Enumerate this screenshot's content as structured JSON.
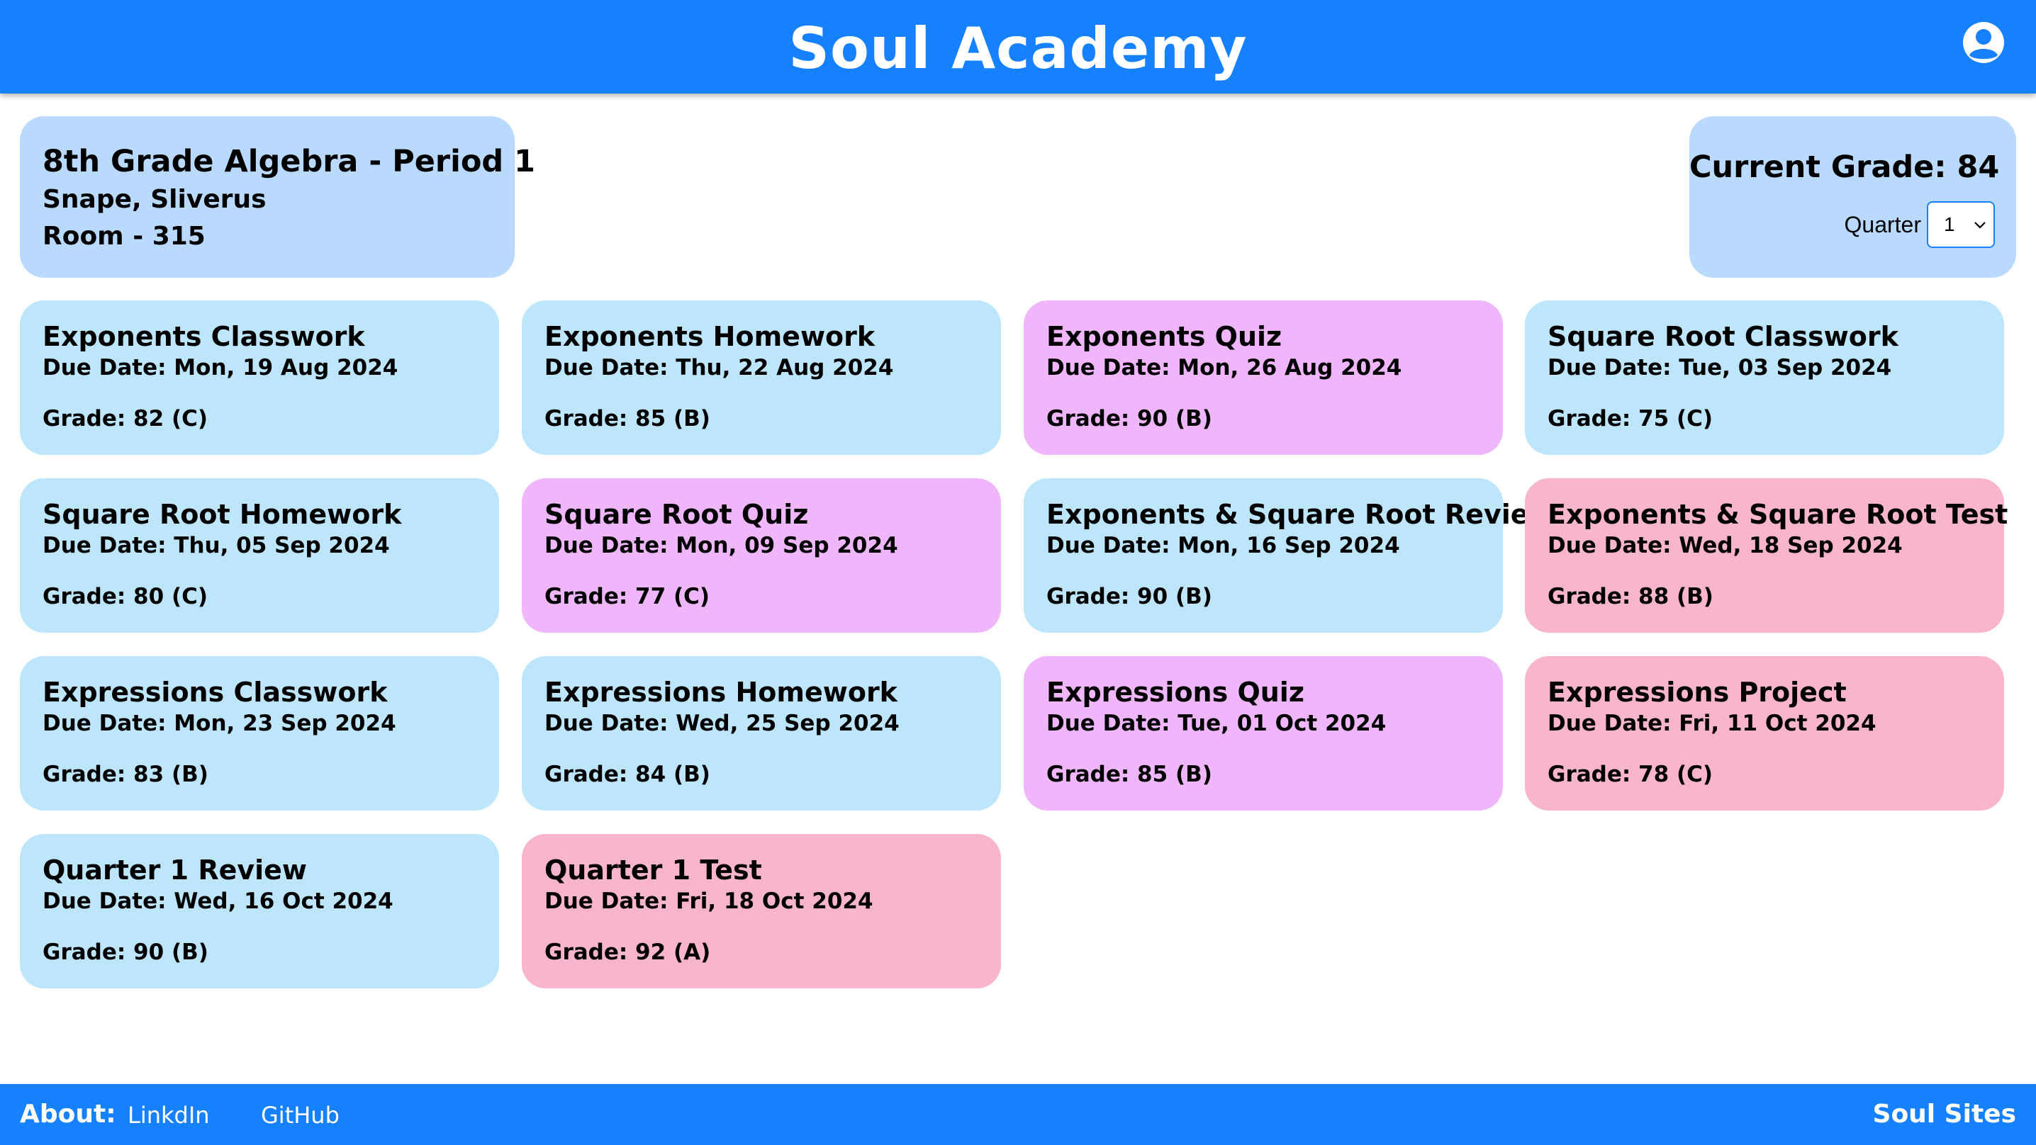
{
  "header": {
    "title": "Soul Academy",
    "account_icon": "account-circle-icon"
  },
  "class_info": {
    "title": "8th Grade Algebra - Period 1",
    "teacher": "Snape, Sliverus",
    "room": "Room - 315"
  },
  "grade_summary": {
    "current_grade": "Current Grade: 84",
    "quarter_label": "Quarter",
    "quarter_value": "1"
  },
  "colors": {
    "brand": "#1681ff",
    "panel": "#b9d9fe",
    "classwork": "#bde6fd",
    "quiz": "#efb6fb",
    "test": "#f8b5cb"
  },
  "assignments": [
    {
      "title": "Exponents Classwork",
      "due": "Due Date: Mon, 19 Aug 2024",
      "grade": "Grade: 82 (C)",
      "kind": "classwork"
    },
    {
      "title": "Exponents Homework",
      "due": "Due Date: Thu, 22 Aug 2024",
      "grade": "Grade: 85 (B)",
      "kind": "classwork"
    },
    {
      "title": "Exponents Quiz",
      "due": "Due Date: Mon, 26 Aug 2024",
      "grade": "Grade: 90 (B)",
      "kind": "quiz"
    },
    {
      "title": "Square Root Classwork",
      "due": "Due Date: Tue, 03 Sep 2024",
      "grade": "Grade: 75 (C)",
      "kind": "classwork"
    },
    {
      "title": "Square Root Homework",
      "due": "Due Date: Thu, 05 Sep 2024",
      "grade": "Grade: 80 (C)",
      "kind": "classwork"
    },
    {
      "title": "Square Root Quiz",
      "due": "Due Date: Mon, 09 Sep 2024",
      "grade": "Grade: 77 (C)",
      "kind": "quiz"
    },
    {
      "title": "Exponents & Square Root Review",
      "due": "Due Date: Mon, 16 Sep 2024",
      "grade": "Grade: 90 (B)",
      "kind": "classwork"
    },
    {
      "title": "Exponents & Square Root Test",
      "due": "Due Date: Wed, 18 Sep 2024",
      "grade": "Grade: 88 (B)",
      "kind": "test"
    },
    {
      "title": "Expressions Classwork",
      "due": "Due Date: Mon, 23 Sep 2024",
      "grade": "Grade: 83 (B)",
      "kind": "classwork"
    },
    {
      "title": "Expressions Homework",
      "due": "Due Date: Wed, 25 Sep 2024",
      "grade": "Grade: 84 (B)",
      "kind": "classwork"
    },
    {
      "title": "Expressions Quiz",
      "due": "Due Date: Tue, 01 Oct 2024",
      "grade": "Grade: 85 (B)",
      "kind": "quiz"
    },
    {
      "title": "Expressions Project",
      "due": "Due Date: Fri, 11 Oct 2024",
      "grade": "Grade: 78 (C)",
      "kind": "test"
    },
    {
      "title": "Quarter 1 Review",
      "due": "Due Date: Wed, 16 Oct 2024",
      "grade": "Grade: 90 (B)",
      "kind": "classwork"
    },
    {
      "title": "Quarter 1 Test",
      "due": "Due Date: Fri, 18 Oct 2024",
      "grade": "Grade: 92 (A)",
      "kind": "test"
    }
  ],
  "footer": {
    "about_label": "About:",
    "links": [
      "LinkdIn",
      "GitHub"
    ],
    "brand": "Soul Sites"
  }
}
